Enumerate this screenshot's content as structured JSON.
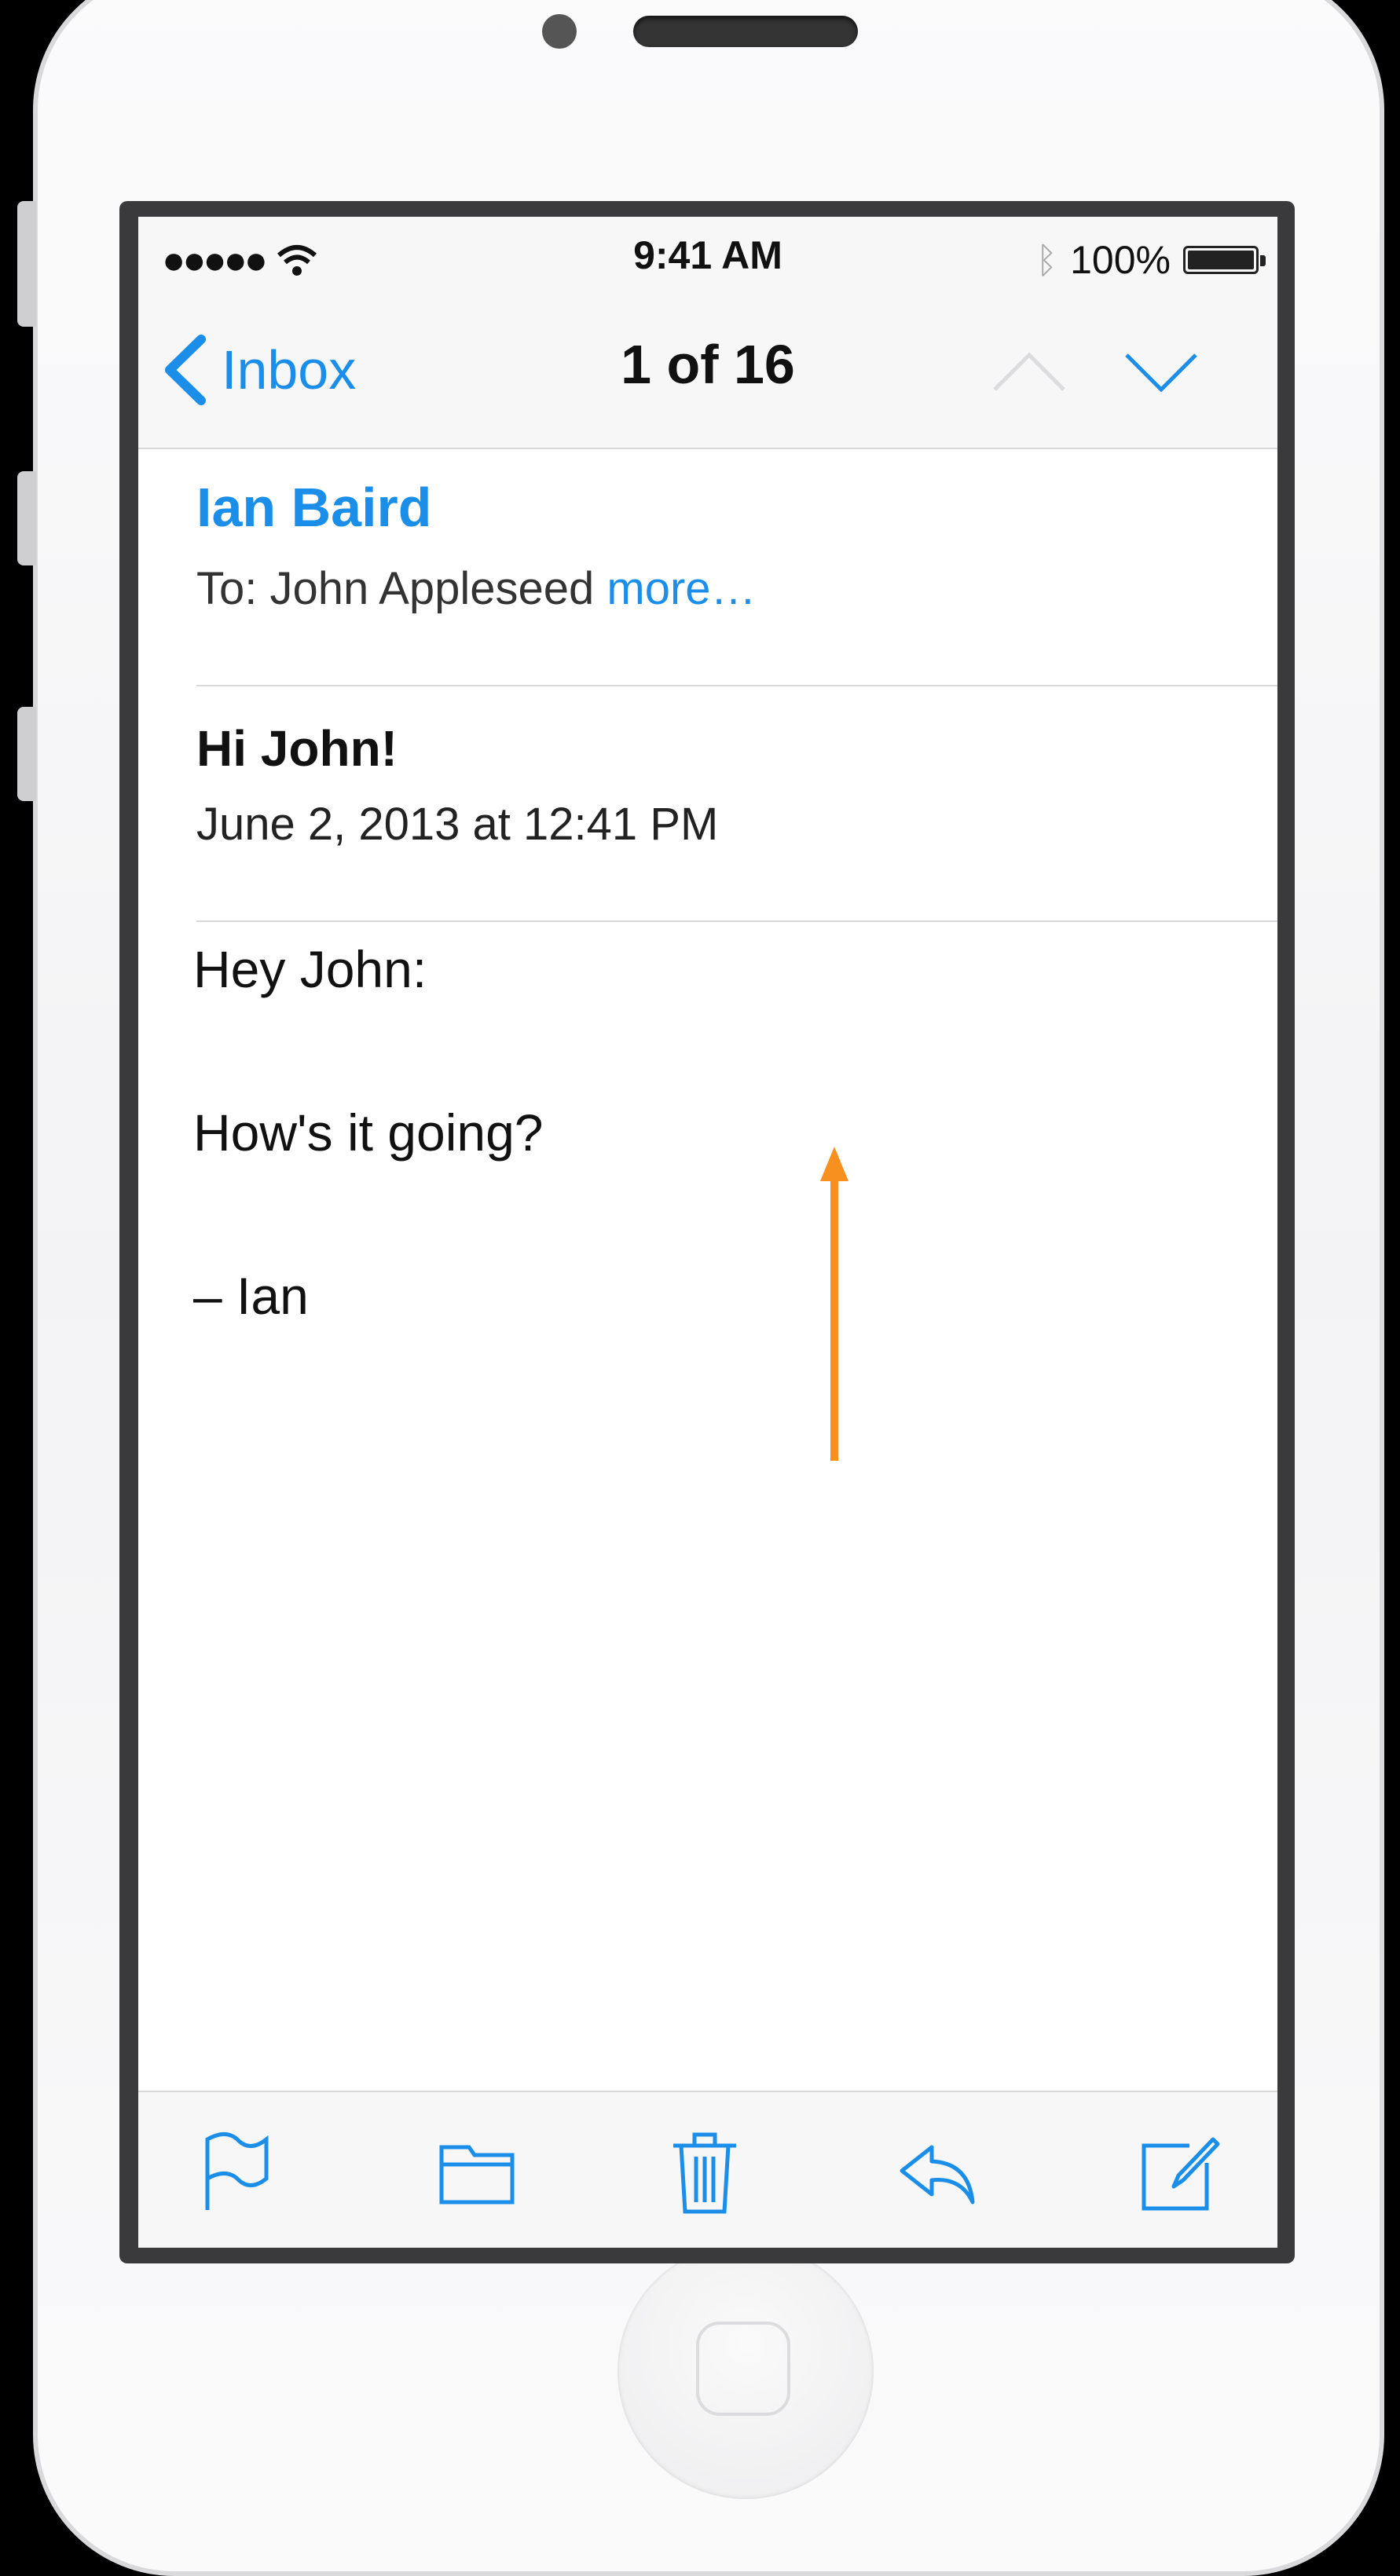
{
  "status_bar": {
    "signal": "●●●●●",
    "time": "9:41 AM",
    "battery_text": "100%",
    "battery_level": 1.0
  },
  "nav": {
    "back_label": "Inbox",
    "title": "1 of 16",
    "prev_icon": "chevron-up-icon",
    "next_icon": "chevron-down-icon"
  },
  "message": {
    "sender": "Ian Baird",
    "to_prefix": "To: John Appleseed ",
    "more_label": "more…",
    "subject": "Hi John!",
    "date": "June 2, 2013 at 12:41 PM",
    "body": [
      "Hey John:",
      "How's it going?",
      "– Ian"
    ]
  },
  "toolbar": {
    "icons": [
      "flag-icon",
      "folder-icon",
      "trash-icon",
      "reply-icon",
      "compose-icon"
    ]
  },
  "colors": {
    "accent": "#1a8ee8",
    "gesture_arrow": "#f7901e"
  }
}
